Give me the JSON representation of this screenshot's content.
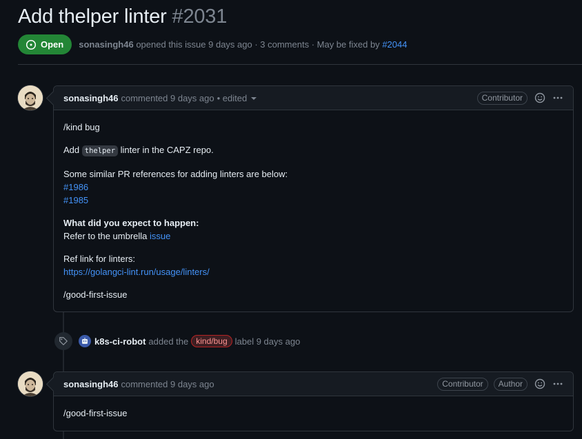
{
  "issue": {
    "title": "Add thelper linter",
    "number": "#2031",
    "state": "Open",
    "meta_author": "sonasingh46",
    "meta_text": "opened this issue 9 days ago · 3 comments · May be fixed by",
    "fixed_by": "#2044"
  },
  "comments": [
    {
      "author": "sonasingh46",
      "action": "commented 9 days ago",
      "edited": "• edited",
      "roles": [
        "Contributor"
      ],
      "body": {
        "line1": "/kind bug",
        "line2_pre": "Add",
        "line2_code": "thelper",
        "line2_post": "linter in the CAPZ repo.",
        "line3": "Some similar PR references for adding linters are below:",
        "ref1": "#1986",
        "ref2": "#1985",
        "heading": "What did you expect to happen:",
        "umbrella_pre": "Refer to the umbrella",
        "umbrella_link": "issue",
        "ref_label": "Ref link for linters:",
        "ref_url": "https://golangci-lint.run/usage/linters/",
        "last": "/good-first-issue"
      }
    },
    {
      "author": "sonasingh46",
      "action": "commented 9 days ago",
      "roles": [
        "Contributor",
        "Author"
      ],
      "body": {
        "line1": "/good-first-issue"
      }
    }
  ],
  "event": {
    "actor": "k8s-ci-robot",
    "pre": "added the",
    "label": "kind/bug",
    "post": "label 9 days ago",
    "label_colors": {
      "bg": "#3d1e22",
      "border": "#b62324",
      "text": "#ff9492"
    }
  },
  "icons": {
    "state": "issue-open-icon",
    "emoji": "smiley-icon",
    "menu": "kebab-horizontal-icon",
    "event": "tag-icon"
  },
  "colors": {
    "background": "#0d1117",
    "header": "#161b22",
    "border": "#30363d",
    "open_green": "#238636",
    "link": "#4493f8",
    "muted": "#7d8590"
  }
}
